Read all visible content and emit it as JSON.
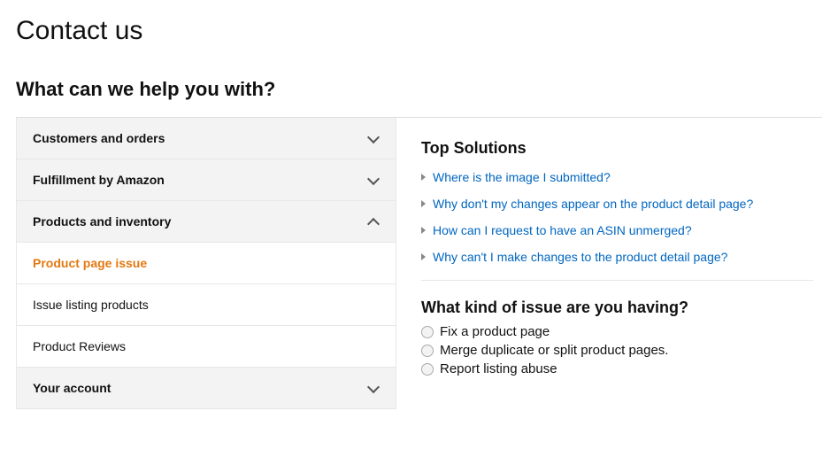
{
  "page_title": "Contact us",
  "help_heading": "What can we help you with?",
  "sidebar": {
    "items": [
      {
        "label": "Customers and orders",
        "expanded": false
      },
      {
        "label": "Fulfillment by Amazon",
        "expanded": false
      },
      {
        "label": "Products and inventory",
        "expanded": true
      },
      {
        "label": "Your account",
        "expanded": false
      }
    ],
    "sub_items": [
      {
        "label": "Product page issue",
        "active": true
      },
      {
        "label": "Issue listing products",
        "active": false
      },
      {
        "label": "Product Reviews",
        "active": false
      }
    ]
  },
  "solutions": {
    "title": "Top Solutions",
    "links": [
      "Where is the image I submitted?",
      "Why don't my changes appear on the product detail page?",
      "How can I request to have an ASIN unmerged?",
      "Why can't I make changes to the product detail page?"
    ]
  },
  "issue": {
    "title": "What kind of issue are you having?",
    "options": [
      "Fix a product page",
      "Merge duplicate or split product pages.",
      "Report listing abuse"
    ]
  }
}
